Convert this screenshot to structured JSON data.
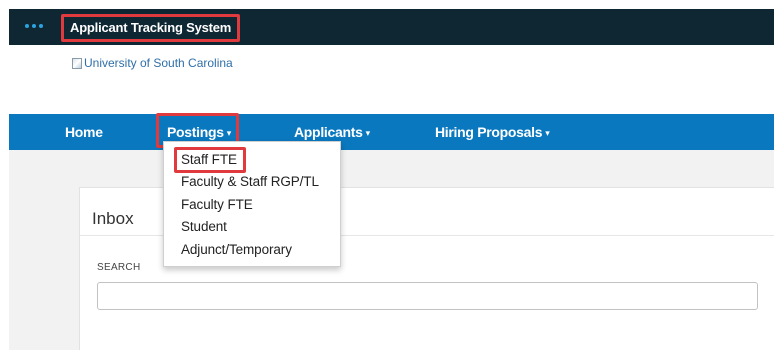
{
  "topbar": {
    "app_title": "Applicant Tracking System",
    "menu_icon": "dots-menu-icon",
    "highlight_color": "#e03a3e"
  },
  "header": {
    "logo_alt": "University of South Carolina",
    "logo_icon": "broken-image-icon"
  },
  "nav": {
    "items": [
      {
        "label": "Home"
      },
      {
        "label": "Postings"
      },
      {
        "label": "Applicants"
      },
      {
        "label": "Hiring Proposals"
      }
    ],
    "caret": "▾",
    "bar_color": "#0a78bf"
  },
  "postings_menu": {
    "items": [
      {
        "label": "Staff FTE"
      },
      {
        "label": "Faculty & Staff RGP/TL"
      },
      {
        "label": "Faculty FTE"
      },
      {
        "label": "Student"
      },
      {
        "label": "Adjunct/Temporary"
      }
    ]
  },
  "inbox": {
    "title": "Inbox",
    "search_label": "SEARCH",
    "search_value": ""
  }
}
